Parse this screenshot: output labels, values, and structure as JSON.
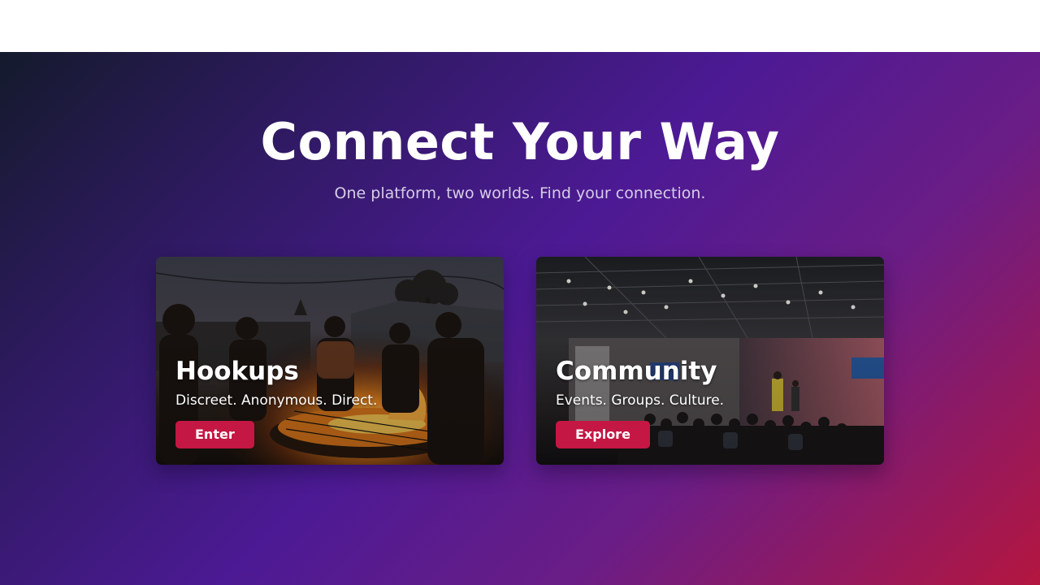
{
  "hero": {
    "title": "Connect Your Way",
    "subtitle": "One platform, two worlds. Find your connection."
  },
  "cards": [
    {
      "title": "Hookups",
      "description": "Discreet. Anonymous. Direct.",
      "button_label": "Enter",
      "image": "people-grilling-at-dusk-photo"
    },
    {
      "title": "Community",
      "description": "Events. Groups. Culture.",
      "button_label": "Explore",
      "image": "community-event-hall-photo"
    }
  ],
  "colors": {
    "button": "#c41744",
    "gradient_start": "#141a2c",
    "gradient_mid": "#4c1a94",
    "gradient_end": "#b4163f",
    "text": "#ffffff"
  }
}
